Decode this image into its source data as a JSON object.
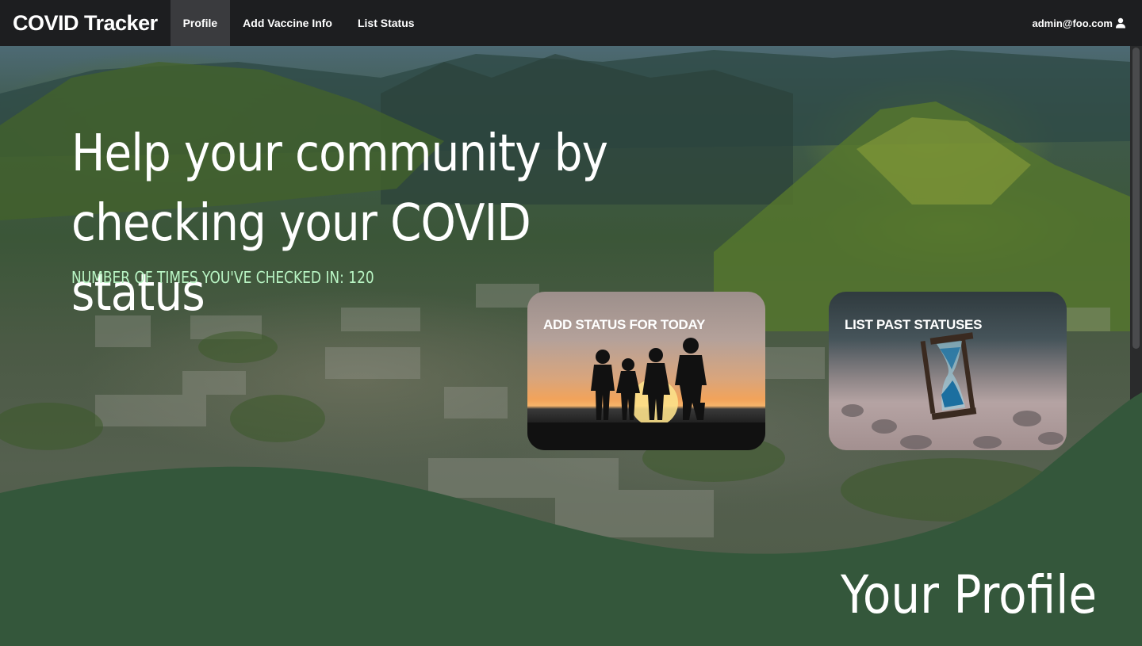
{
  "navbar": {
    "brand": "COVID Tracker",
    "items": [
      {
        "label": "Profile",
        "active": true
      },
      {
        "label": "Add Vaccine Info",
        "active": false
      },
      {
        "label": "List Status",
        "active": false
      }
    ],
    "user": "admin@foo.com",
    "user_icon": "user-icon"
  },
  "hero": {
    "headline_line1": "Help your community by",
    "headline_line2": "checking your COVID status",
    "checkin_text": "NUMBER OF TIMES YOU'VE CHECKED IN: 120"
  },
  "cards": [
    {
      "title": "ADD STATUS FOR TODAY",
      "image": "family-sunset-silhouette"
    },
    {
      "title": "LIST PAST STATUSES",
      "image": "hourglass-on-pebbles"
    }
  ],
  "profile_section": {
    "heading": "Your Profile"
  },
  "colors": {
    "navbar": "#1d1e20",
    "navbar_active": "#3a3b3e",
    "section_green": "#34573b",
    "checkin_text": "#b9f5c4"
  }
}
